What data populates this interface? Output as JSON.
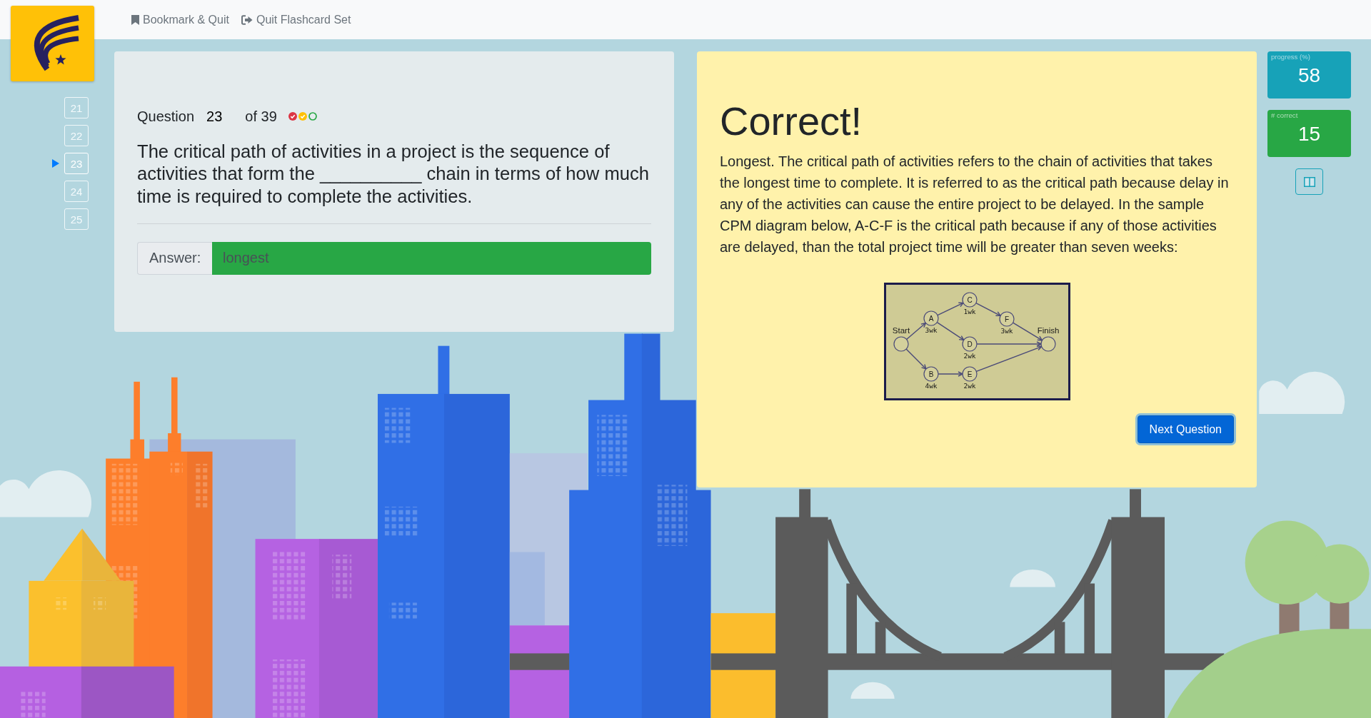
{
  "top_nav": {
    "links": [
      {
        "kind": "bookmark",
        "label": "Bookmark & Quit"
      },
      {
        "kind": "exit",
        "label": "Quit Flashcard Set"
      }
    ]
  },
  "question_nav": [
    {
      "label": "21",
      "selected": false
    },
    {
      "label": "22",
      "selected": false
    },
    {
      "label": "23",
      "selected": true
    },
    {
      "label": "24",
      "selected": false
    },
    {
      "label": "25",
      "selected": false
    }
  ],
  "question_card": {
    "label": "Question",
    "number": "23",
    "total": "of 39",
    "status_icons": [
      {
        "kind": "checked",
        "color": "#dc3545"
      },
      {
        "kind": "checked",
        "color": "#ffc107"
      },
      {
        "kind": "empty",
        "color": "#28a745"
      }
    ],
    "text": "The critical path of activities in a project is the sequence of activities that form the __________ chain in terms of how much time is required to complete the activities.",
    "answer": {
      "label": "Answer:",
      "value": "longest",
      "correct": true
    }
  },
  "feedback": {
    "title": "Correct!",
    "explanation": "Longest. The critical path of activities refers to the chain of activities that takes the longest time to complete. It is referred to as the critical path because delay in any of the activities can cause the entire project to be delayed. In the sample CPM diagram below, A-C-F is the critical path because if any of those activities are delayed, than the total project time will be greater than seven weeks:",
    "diagram": {
      "nodes": [
        {
          "kind": "terminal",
          "label": "Start"
        },
        {
          "kind": "activity",
          "label": "A",
          "duration": "3wk"
        },
        {
          "kind": "activity",
          "label": "B",
          "duration": "4wk"
        },
        {
          "kind": "activity",
          "label": "C",
          "duration": "1wk"
        },
        {
          "kind": "activity",
          "label": "D",
          "duration": "2wk"
        },
        {
          "kind": "activity",
          "label": "E",
          "duration": "2wk"
        },
        {
          "kind": "activity",
          "label": "F",
          "duration": "3wk"
        },
        {
          "kind": "terminal",
          "label": "Finish"
        }
      ]
    },
    "button": "Next Question"
  },
  "stats": [
    {
      "label": "progress (%)",
      "value": "58",
      "color": "#17a2b8"
    },
    {
      "label": "# correct",
      "value": "15",
      "color": "#28a745"
    }
  ]
}
